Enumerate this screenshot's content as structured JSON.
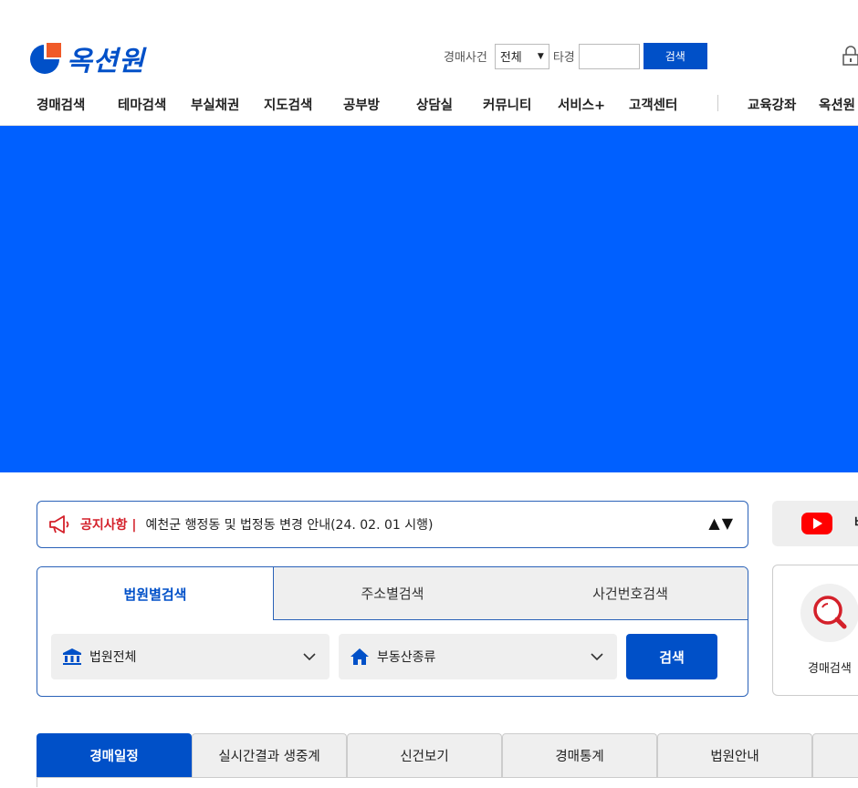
{
  "logo": {
    "text": "옥션원"
  },
  "header_search": {
    "label": "경매사건",
    "court_select": "전체",
    "label2": "타경",
    "case_input": "",
    "button": "검색"
  },
  "nav": {
    "items": [
      "경매검색",
      "테마검색",
      "부실채권",
      "지도검색",
      "공부방",
      "상담실",
      "커뮤니티",
      "서비스+",
      "고객센터",
      "교육강좌",
      "옥션원"
    ]
  },
  "notice": {
    "title": "공지사항 |",
    "text": "예천군 행정동 및 법정동 변경 안내(24. 02. 01 시행)",
    "arrows": "▲▼"
  },
  "youtube": {
    "label": "버"
  },
  "search_panel": {
    "tabs": [
      "법원별검색",
      "주소별검색",
      "사건번호검색"
    ],
    "court_dropdown": "법원전체",
    "type_dropdown": "부동산종류",
    "button": "검색"
  },
  "quick": {
    "label": "경매검색"
  },
  "bottom_tabs": [
    "경매일정",
    "실시간결과 생중계",
    "신건보기",
    "경매통계",
    "법원안내"
  ],
  "colors": {
    "brand": "#0050c8",
    "banner": "#0060ff",
    "accent": "#f05a28",
    "notice_red": "#d4202a"
  }
}
